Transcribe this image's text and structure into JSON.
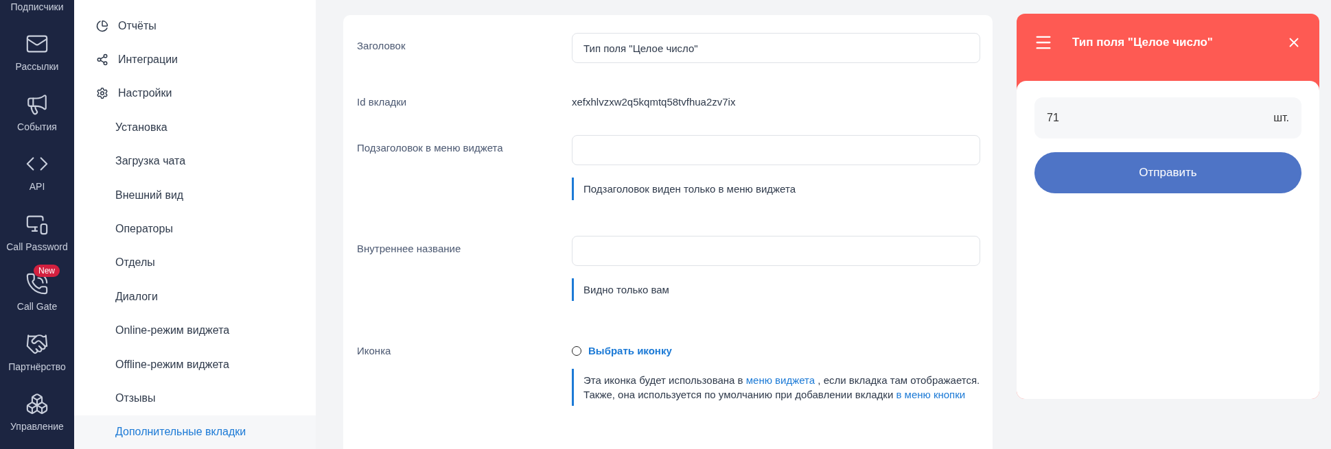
{
  "rail": {
    "items": [
      {
        "label": "Подписчики"
      },
      {
        "label": "Рассылки"
      },
      {
        "label": "События"
      },
      {
        "label": "API"
      },
      {
        "label": "Call Password"
      },
      {
        "label": "Call Gate",
        "badge": "New"
      },
      {
        "label": "Партнёрство"
      },
      {
        "label": "Управление"
      }
    ]
  },
  "nav": {
    "items": [
      {
        "kind": "section",
        "label": "Отчёты",
        "selected": false
      },
      {
        "kind": "section",
        "label": "Интеграции",
        "selected": false
      },
      {
        "kind": "section",
        "label": "Настройки",
        "selected": false
      },
      {
        "kind": "sub",
        "label": "Установка",
        "selected": false
      },
      {
        "kind": "sub",
        "label": "Загрузка чата",
        "selected": false
      },
      {
        "kind": "sub",
        "label": "Внешний вид",
        "selected": false
      },
      {
        "kind": "sub",
        "label": "Операторы",
        "selected": false
      },
      {
        "kind": "sub",
        "label": "Отделы",
        "selected": false
      },
      {
        "kind": "sub",
        "label": "Диалоги",
        "selected": false
      },
      {
        "kind": "sub",
        "label": "Online-режим виджета",
        "selected": false
      },
      {
        "kind": "sub",
        "label": "Offline-режим виджета",
        "selected": false
      },
      {
        "kind": "sub",
        "label": "Отзывы",
        "selected": false
      },
      {
        "kind": "sub",
        "label": "Дополнительные вкладки",
        "selected": true
      }
    ]
  },
  "form": {
    "rows": [
      {
        "kind": "input",
        "label": "Заголовок",
        "value": "Тип поля \"Целое число\""
      },
      {
        "kind": "text",
        "label": "Id вкладки",
        "value": "xefxhlvzxw2q5kqmtq58tvfhua2zv7ix"
      },
      {
        "kind": "input",
        "label": "Подзаголовок в меню виджета",
        "value": "",
        "note": [
          [
            {
              "kind": "text",
              "text": "Подзаголовок виден только в меню виджета"
            }
          ]
        ]
      },
      {
        "kind": "input",
        "label": "Внутреннее название",
        "value": "",
        "note": [
          [
            {
              "kind": "text",
              "text": "Видно только вам"
            }
          ]
        ]
      },
      {
        "kind": "icon-picker",
        "label": "Иконка",
        "choice": "Выбрать иконку",
        "checked": false,
        "note": [
          [
            {
              "kind": "text",
              "text": "Эта иконка будет использована в "
            },
            {
              "kind": "link",
              "text": "меню виджета"
            },
            {
              "kind": "text",
              "text": " , если вкладка там отображается."
            }
          ],
          [
            {
              "kind": "text",
              "text": "Также, она используется по умолчанию при добавлении вкладки "
            },
            {
              "kind": "link",
              "text": "в меню кнопки"
            }
          ]
        ]
      }
    ]
  },
  "widget": {
    "title": "Тип поля \"Целое число\"",
    "value": "71",
    "unit": "шт.",
    "button": "Отправить"
  }
}
